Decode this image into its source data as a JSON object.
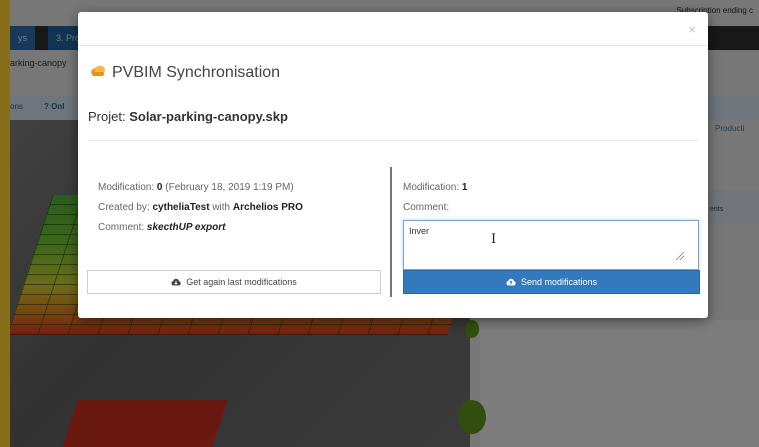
{
  "background_app": {
    "nav_tab_a": "ys",
    "nav_tab_b": "3. Proc",
    "timer_text": "Subscription ending c",
    "file_label": "arking-canopy",
    "subtab_a": "ons",
    "subtab_b": "? Onl",
    "right_link": "Producti",
    "right_label": "ents"
  },
  "modal": {
    "close_label": "×",
    "title": "PVBIM Synchronisation",
    "project_label": "Projet:",
    "project_name": "Solar-parking-canopy.skp",
    "left": {
      "modification_label": "Modification:",
      "modification_number": "0",
      "modification_date": "(February 18, 2019 1:19 PM)",
      "created_label": "Created by:",
      "created_user": "cytheliaTest",
      "created_with": "with",
      "created_app": "Archelios PRO",
      "comment_label": "Comment:",
      "comment_value": "skecthUP export",
      "button_label": "Get again last modifications"
    },
    "right": {
      "modification_label": "Modification:",
      "modification_number": "1",
      "comment_label": "Comment:",
      "comment_input_value": "Inver",
      "button_label": "Send modifications"
    }
  },
  "colors": {
    "accent": "#3279bd",
    "logo_orange": "#f0a030",
    "frame_yellow": "#f5c830"
  },
  "icons": {
    "logo": "pvbim-cloud-icon",
    "get_button": "cloud-download-icon",
    "send_button": "cloud-upload-icon",
    "close": "close-icon"
  }
}
